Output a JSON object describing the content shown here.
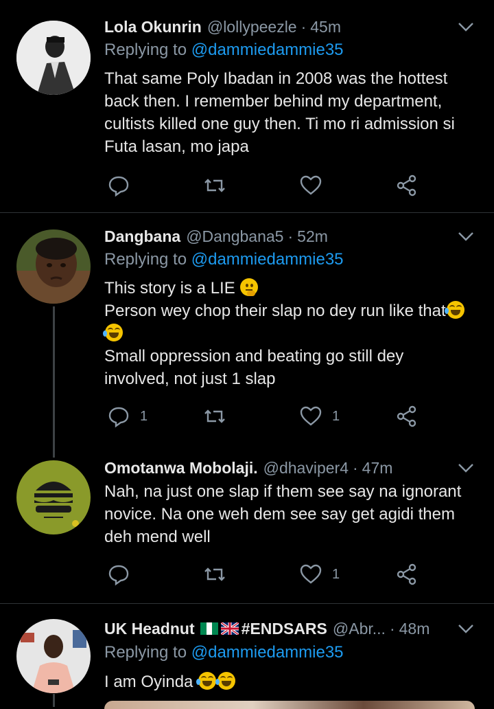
{
  "tweets": [
    {
      "name": "Lola Okunrin",
      "handle": "@lollypeezle",
      "time": "45m",
      "replying_prefix": "Replying to",
      "mention": "@dammiedammie35",
      "text_lines": [
        "That same Poly Ibadan in 2008 was the hottest",
        "back then. I remember behind my department,",
        "cultists killed one guy then. Ti mo ri admission si",
        "Futa lasan, mo japa"
      ],
      "reply_count": "",
      "like_count": ""
    },
    {
      "name": "Dangbana",
      "handle": "@Dangbana5",
      "time": "52m",
      "replying_prefix": "Replying to",
      "mention": "@dammiedammie35",
      "text_lines": [
        "This story is a LIE",
        "Person wey chop their slap no dey run like that",
        "",
        "Small oppression and beating go still dey",
        "involved, not just 1 slap"
      ],
      "reply_count": "1",
      "like_count": "1"
    },
    {
      "name": "Omotanwa Mobolaji.",
      "handle": "@dhaviper4",
      "time": "47m",
      "text_lines": [
        "Nah, na just one slap if them see say na ignorant",
        "novice. Na one weh dem see say get agidi them",
        "deh mend well"
      ],
      "reply_count": "",
      "like_count": "1"
    },
    {
      "name": "UK Headnut",
      "name_tag": "#ENDSARS",
      "handle": "@Abr...",
      "time": "48m",
      "replying_prefix": "Replying to",
      "mention": "@dammiedammie35",
      "text_lines": [
        "I am Oyinda"
      ]
    }
  ],
  "colors": {
    "background": "#000000",
    "name": "#e8e8e8",
    "muted": "#8b98a5",
    "mention": "#1d9bf0",
    "divider": "#2f3336"
  },
  "icons": [
    "reply-icon",
    "retweet-icon",
    "like-icon",
    "share-icon",
    "chevron-down-icon"
  ]
}
